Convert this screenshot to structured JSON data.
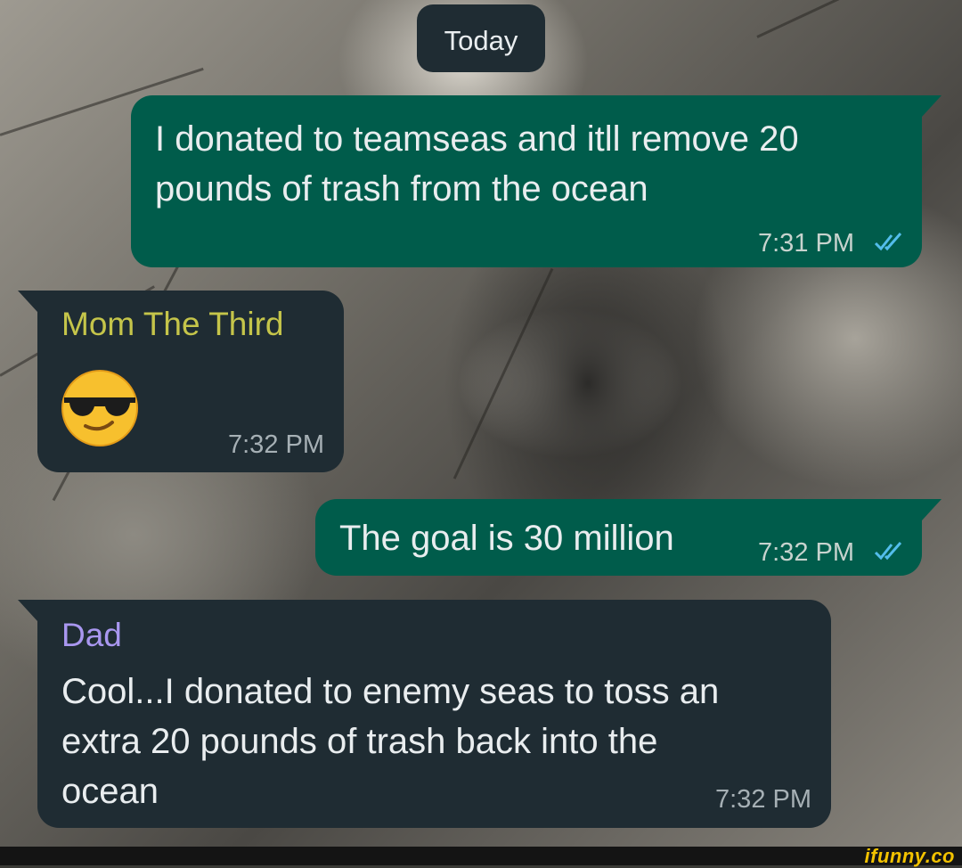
{
  "chat": {
    "date_divider": "Today",
    "messages": [
      {
        "direction": "outgoing",
        "text": "I donated to teamseas and itll remove 20\npounds of trash from the ocean",
        "time": "7:31 PM",
        "status": "read-double-check-icon"
      },
      {
        "direction": "incoming",
        "sender": "Mom The Third",
        "sender_color": "#c5c54a",
        "content": "smiling-face-with-sunglasses-emoji",
        "time": "7:32 PM"
      },
      {
        "direction": "outgoing",
        "text": "The goal is 30 million",
        "time": "7:32 PM",
        "status": "read-double-check-icon"
      },
      {
        "direction": "incoming",
        "sender": "Dad",
        "sender_color": "#a997f0",
        "text": "Cool...I donated to enemy seas to toss an\nextra 20 pounds of trash back into the\nocean",
        "time": "7:32 PM"
      }
    ]
  },
  "watermark": "ifunny.co",
  "colors": {
    "outgoing_bubble": "#005c4b",
    "incoming_bubble": "#1f2c33",
    "read_tick": "#53bdeb",
    "text": "#e9edef"
  }
}
